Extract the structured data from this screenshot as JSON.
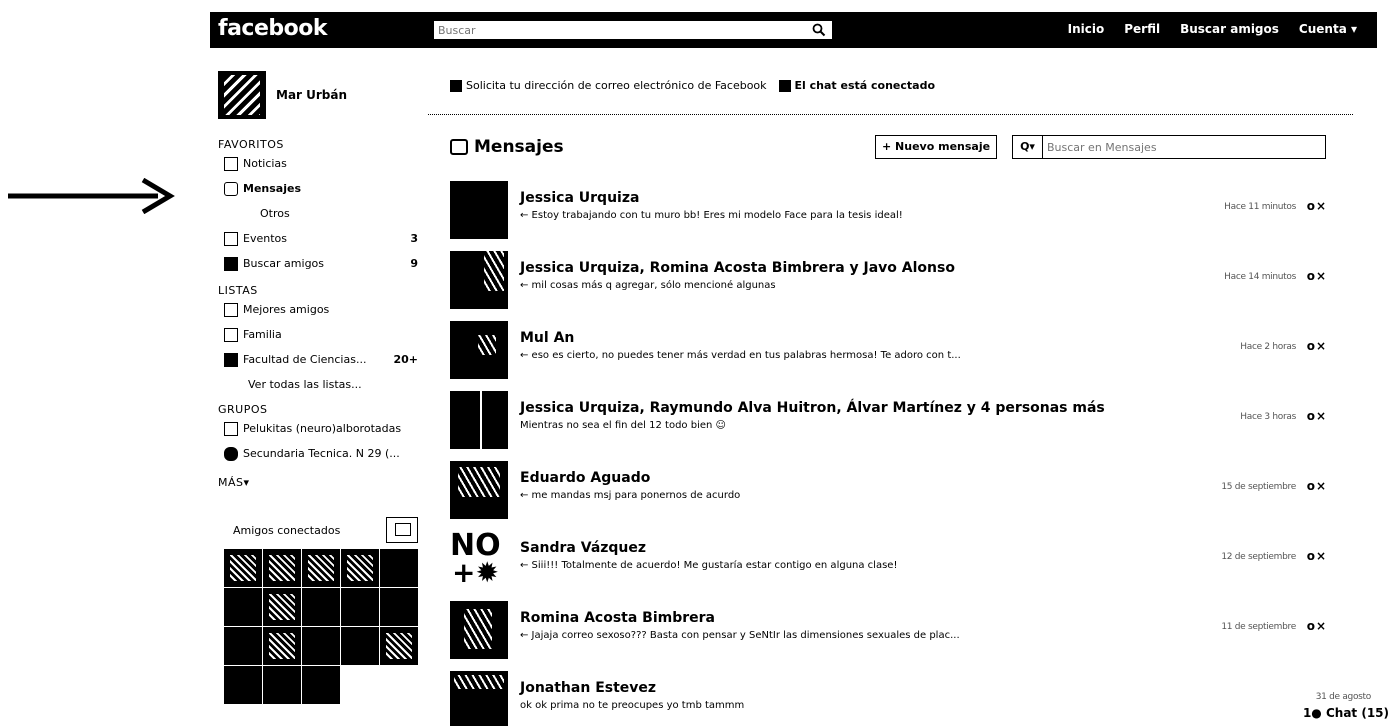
{
  "topbar": {
    "logo": "facebook",
    "search_placeholder": "Buscar",
    "nav": [
      "Inicio",
      "Perfil",
      "Buscar amigos",
      "Cuenta ▾"
    ]
  },
  "sidebar": {
    "user_name": "Mar Urbán",
    "favorites_title": "FAVORITOS",
    "favorites": [
      {
        "label": "Noticias",
        "count": ""
      },
      {
        "label": "Mensajes",
        "count": ""
      },
      {
        "label": "Otros",
        "count": ""
      },
      {
        "label": "Eventos",
        "count": "3"
      },
      {
        "label": "Buscar amigos",
        "count": "9"
      }
    ],
    "lists_title": "LISTAS",
    "lists": [
      {
        "label": "Mejores amigos",
        "count": ""
      },
      {
        "label": "Familia",
        "count": ""
      },
      {
        "label": "Facultad de Ciencias...",
        "count": "20+"
      }
    ],
    "lists_more": "Ver todas las listas...",
    "groups_title": "GRUPOS",
    "groups": [
      {
        "label": "Pelukitas (neuro)alborotadas"
      },
      {
        "label": "Secundaria Tecnica. N 29 (..."
      }
    ],
    "more": "MÁS▾",
    "online_title": "Amigos conectados"
  },
  "notice": {
    "email_text": "Solicita tu dirección de correo electrónico de Facebook",
    "chat_text": "El chat está conectado"
  },
  "messages": {
    "title": "Mensajes",
    "new_button": "+ Nuevo mensaje",
    "search_placeholder": "Buscar en Mensajes",
    "items": [
      {
        "sender": "Jessica Urquiza",
        "snippet": "← Estoy trabajando con tu muro bb! Eres mi modelo Face para la tesis ideal!",
        "time": "Hace 11 minutos"
      },
      {
        "sender": "Jessica Urquiza, Romina Acosta Bimbrera y Javo Alonso",
        "snippet": "← mil cosas más q agregar, sólo mencioné algunas",
        "time": "Hace 14 minutos"
      },
      {
        "sender": "Mul An",
        "snippet": "← eso es cierto, no puedes tener más verdad en tus palabras hermosa! Te adoro con t...",
        "time": "Hace 2 horas"
      },
      {
        "sender": "Jessica Urquiza, Raymundo Alva Huitron, Álvar Martínez y 4 personas más",
        "snippet": "Mientras no sea el fin del 12 todo bien ☺",
        "time": "Hace 3 horas"
      },
      {
        "sender": "Eduardo Aguado",
        "snippet": "← me mandas msj para ponernos de acurdo",
        "time": "15 de septiembre"
      },
      {
        "sender": "Sandra Vázquez",
        "snippet": "← Siii!!! Totalmente de acuerdo! Me gustaría estar contigo en alguna clase!",
        "time": "12 de septiembre"
      },
      {
        "sender": "Romina Acosta Bimbrera",
        "snippet": "← Jajaja correo sexoso??? Basta con pensar y SeNtIr las dimensiones sexuales de plac...",
        "time": "11 de septiembre"
      },
      {
        "sender": "Jonathan Estevez",
        "snippet": "ok ok prima no te preocupes yo tmb tammm",
        "time": "31 de agosto"
      }
    ]
  },
  "chat": {
    "label": "Chat (15)"
  }
}
